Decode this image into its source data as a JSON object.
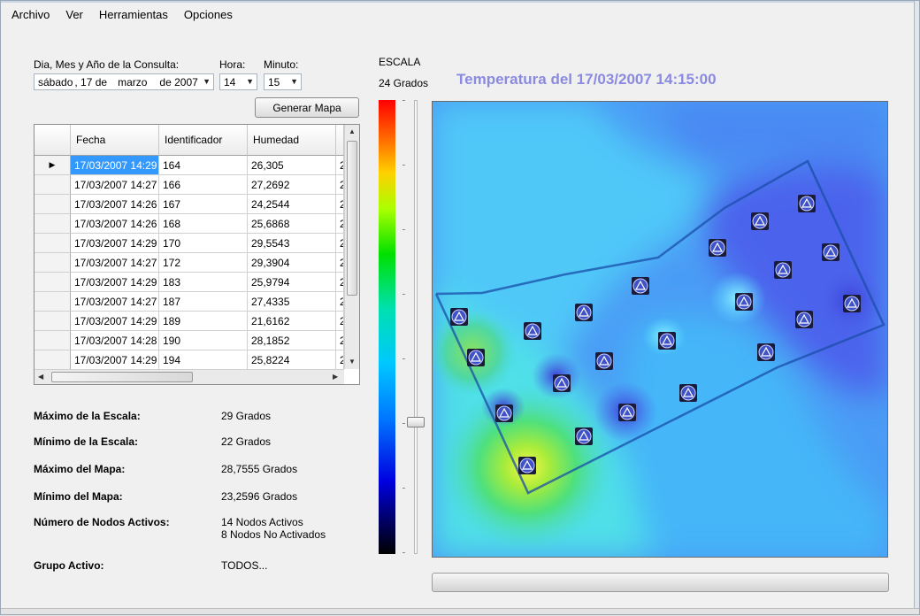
{
  "menu": [
    "Archivo",
    "Ver",
    "Herramientas",
    "Opciones"
  ],
  "query": {
    "date_label": "Dia, Mes y Año de la Consulta:",
    "hour_label": "Hora:",
    "minute_label": "Minuto:",
    "date": {
      "weekday": "sábado",
      "day": ", 17 de",
      "month": "marzo",
      "year": "de 2007"
    },
    "hour": "14",
    "minute": "15",
    "generate_button": "Generar Mapa"
  },
  "table": {
    "columns": [
      "Fecha",
      "Identificador",
      "Humedad"
    ],
    "rows": [
      {
        "fecha": "17/03/2007 14:29",
        "id": "164",
        "humedad": "26,305",
        "extra": "2"
      },
      {
        "fecha": "17/03/2007 14:27",
        "id": "166",
        "humedad": "27,2692",
        "extra": "2"
      },
      {
        "fecha": "17/03/2007 14:26",
        "id": "167",
        "humedad": "24,2544",
        "extra": "2"
      },
      {
        "fecha": "17/03/2007 14:26",
        "id": "168",
        "humedad": "25,6868",
        "extra": "2"
      },
      {
        "fecha": "17/03/2007 14:29",
        "id": "170",
        "humedad": "29,5543",
        "extra": "2"
      },
      {
        "fecha": "17/03/2007 14:27",
        "id": "172",
        "humedad": "29,3904",
        "extra": "2"
      },
      {
        "fecha": "17/03/2007 14:29",
        "id": "183",
        "humedad": "25,9794",
        "extra": "2"
      },
      {
        "fecha": "17/03/2007 14:27",
        "id": "187",
        "humedad": "27,4335",
        "extra": "2"
      },
      {
        "fecha": "17/03/2007 14:29",
        "id": "189",
        "humedad": "21,6162",
        "extra": "2"
      },
      {
        "fecha": "17/03/2007 14:28",
        "id": "190",
        "humedad": "28,1852",
        "extra": "2"
      },
      {
        "fecha": "17/03/2007 14:29",
        "id": "194",
        "humedad": "25,8224",
        "extra": "2"
      }
    ]
  },
  "info": {
    "max_scale_label": "Máximo de la Escala:",
    "max_scale_value": "29 Grados",
    "min_scale_label": "Mínimo de la Escala:",
    "min_scale_value": "22 Grados",
    "max_map_label": "Máximo del Mapa:",
    "max_map_value": "28,7555 Grados",
    "min_map_label": "Mínimo del Mapa:",
    "min_map_value": "23,2596 Grados",
    "nodes_label": "Número de Nodos Activos:",
    "nodes_active": "14 Nodos Activos",
    "nodes_inactive": "8 Nodos No Activados",
    "group_label": "Grupo Activo:",
    "group_value": "TODOS..."
  },
  "scale": {
    "title": "ESCALA",
    "value": "24 Grados"
  },
  "map": {
    "title": "Temperatura del 17/03/2007 14:15:00",
    "node_icon": "node-sensor-icon",
    "background_color": "#4a9cf5"
  }
}
